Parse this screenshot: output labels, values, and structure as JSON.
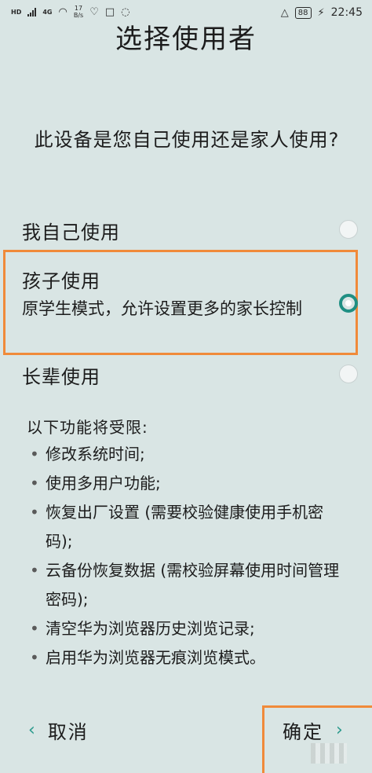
{
  "status_bar": {
    "network_tag_1": "HD",
    "network_tag_2": "4G",
    "speed_value": "17",
    "speed_unit": "B/s",
    "battery_level": "88",
    "time": "22:45"
  },
  "title": "选择使用者",
  "question": "此设备是您自己使用还是家人使用?",
  "options": [
    {
      "label": "我自己使用",
      "desc": "",
      "selected": false
    },
    {
      "label": "孩子使用",
      "desc": "原学生模式，允许设置更多的家长控制",
      "selected": true
    },
    {
      "label": "长辈使用",
      "desc": "",
      "selected": false
    }
  ],
  "restrictions": {
    "title": "以下功能将受限:",
    "items": [
      "修改系统时间;",
      "使用多用户功能;",
      "恢复出厂设置 (需要校验健康使用手机密码);",
      "云备份恢复数据 (需校验屏幕使用时间管理密码);",
      "清空华为浏览器历史浏览记录;",
      "启用华为浏览器无痕浏览模式。"
    ]
  },
  "footer": {
    "cancel_label": "取消",
    "confirm_label": "确定"
  },
  "colors": {
    "background": "#d9e5e4",
    "accent": "#1f8f83",
    "highlight": "#f08a3a"
  }
}
